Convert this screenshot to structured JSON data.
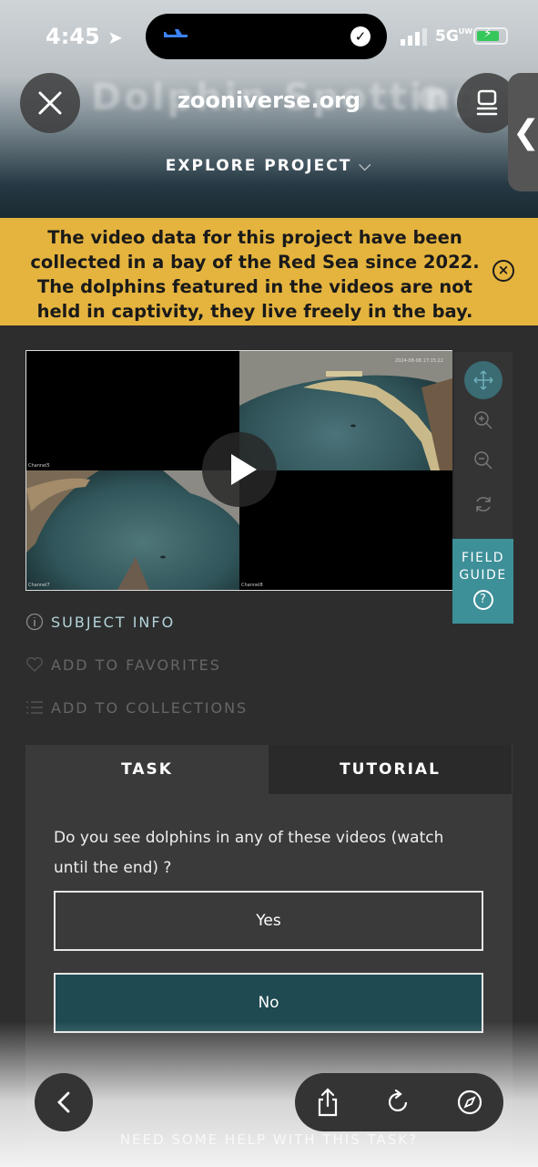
{
  "status": {
    "time": "4:45",
    "network": "5G",
    "network_sup": "UW"
  },
  "browser": {
    "url": "zooniverse.org",
    "ghost_title": "Dolphin Spotting",
    "explore_label": "EXPLORE PROJECT"
  },
  "banner": {
    "text": "The video data for this project have been collected in a bay of the Red Sea since 2022. The dolphins featured in the videos are not held in captivity, they live freely in the bay."
  },
  "video": {
    "timestamp": "2024-08-08 17:15:22",
    "channels": [
      "Channel5",
      "Channel7",
      "Channel8"
    ]
  },
  "field_guide": {
    "line1": "FIELD",
    "line2": "GUIDE",
    "icon": "?"
  },
  "links": {
    "subject_info": "SUBJECT INFO",
    "add_favorites": "ADD TO FAVORITES",
    "add_collections": "ADD TO COLLECTIONS"
  },
  "tabs": {
    "task": "TASK",
    "tutorial": "TUTORIAL"
  },
  "task": {
    "question": "Do you see dolphins in any of these videos (watch until the end) ?",
    "answers": [
      "Yes",
      "No"
    ],
    "help": "NEED SOME HELP WITH THIS TASK?"
  },
  "colors": {
    "banner": "#e5b43e",
    "accent": "#3d8f98",
    "selected_answer": "#1f4a52"
  }
}
